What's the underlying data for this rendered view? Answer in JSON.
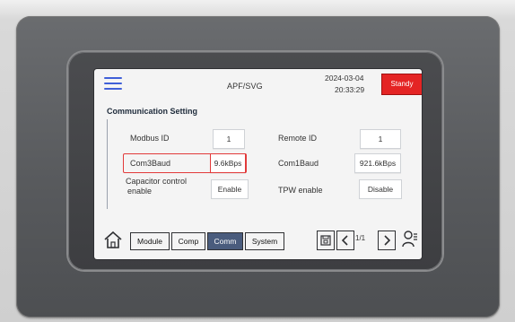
{
  "header": {
    "title": "APF/SVG",
    "date": "2024-03-04",
    "time": "20:33:29",
    "status_button": "Standy"
  },
  "section": {
    "title": "Communication Setting"
  },
  "settings": {
    "modbus_id_label": "Modbus ID",
    "modbus_id_value": "1",
    "remote_id_label": "Remote ID",
    "remote_id_value": "1",
    "com3baud_label": "Com3Baud",
    "com3baud_value": "9.6kBps",
    "com1baud_label": "Com1Baud",
    "com1baud_value": "921.6kBps",
    "capacitor_control_label_line1": "Capacitor control",
    "capacitor_control_label_line2": "enable",
    "capacitor_control_value": "Enable",
    "tpw_enable_label": "TPW enable",
    "tpw_enable_value": "Disable"
  },
  "bottom_nav": {
    "module": "Module",
    "comp": "Comp",
    "comm": "Comm",
    "system": "System",
    "page": "1/1"
  },
  "icons": {
    "menu": "menu-icon",
    "home": "home-icon",
    "save": "save-icon",
    "prev": "chevron-left-icon",
    "next": "chevron-right-icon",
    "user": "user-settings-icon"
  },
  "colors": {
    "status_red": "#e42424",
    "accent_blue": "#3f5fd8",
    "active_tab": "#4a5c7d",
    "highlight_red": "#e23a3a"
  }
}
